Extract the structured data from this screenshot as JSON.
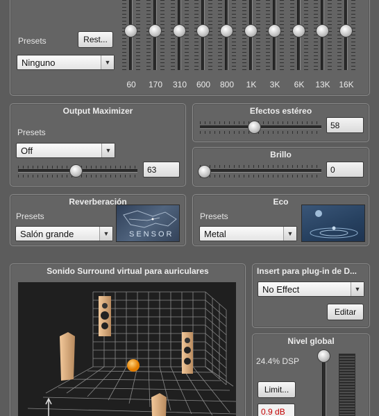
{
  "equalizer": {
    "presets_label": "Presets",
    "reset_button": "Rest...",
    "preset_value": "Ninguno",
    "bands": [
      {
        "label": "60"
      },
      {
        "label": "170"
      },
      {
        "label": "310"
      },
      {
        "label": "600"
      },
      {
        "label": "800"
      },
      {
        "label": "1K"
      },
      {
        "label": "3K"
      },
      {
        "label": "6K"
      },
      {
        "label": "13K"
      },
      {
        "label": "16K"
      }
    ]
  },
  "output_maximizer": {
    "title": "Output Maximizer",
    "presets_label": "Presets",
    "preset_value": "Off",
    "value": "63"
  },
  "stereo_effects": {
    "title": "Efectos estéreo",
    "value": "58"
  },
  "brightness": {
    "title": "Brillo",
    "value": "0"
  },
  "reverb": {
    "title": "Reverberación",
    "presets_label": "Presets",
    "preset_value": "Salón grande",
    "thumbnail_text": "SENSOR"
  },
  "echo": {
    "title": "Eco",
    "presets_label": "Presets",
    "preset_value": "Metal"
  },
  "surround": {
    "title": "Sonido Surround virtual para auriculares"
  },
  "plugin": {
    "title": "Insert para plug-in de D...",
    "preset_value": "No Effect",
    "edit_button": "Editar"
  },
  "global_level": {
    "title": "Nivel global",
    "dsp_text": "24.4% DSP",
    "limit_button": "Limit...",
    "db_value": "0.9 dB"
  },
  "colors": {
    "accent_red": "#c40000",
    "panel": "#646464",
    "background": "#5c5c5c"
  }
}
